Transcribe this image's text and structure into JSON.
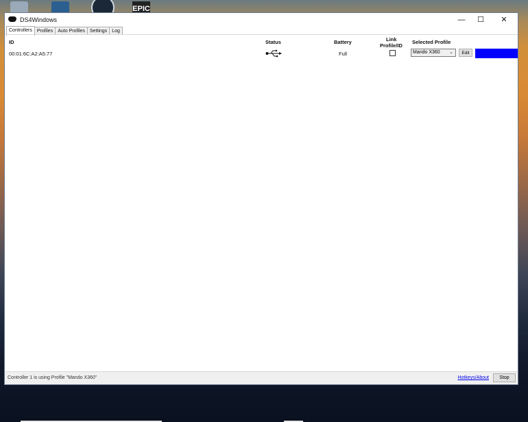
{
  "desktop": {
    "icons": [
      "recycle-bin-icon",
      "ds4windows-icon",
      "steam-icon",
      "epic-games-icon"
    ],
    "epic_label": "EPIC"
  },
  "window": {
    "title": "DS4Windows",
    "controls": {
      "minimize": "—",
      "maximize": "☐",
      "close": "✕"
    }
  },
  "tabs": [
    "Controllers",
    "Profiles",
    "Auto Profiles",
    "Settings",
    "Log"
  ],
  "table": {
    "headers": {
      "id": "ID",
      "status": "Status",
      "battery": "Battery",
      "link_line1": "Link",
      "link_line2": "Profile/ID",
      "selected_profile": "Selected Profile"
    },
    "rows": [
      {
        "id": "00:01:6C:A2:A5:77",
        "status_icon": "usb-icon",
        "battery": "Full",
        "link_checked": false,
        "profile": "Mando X360",
        "edit_label": "Edit",
        "lightbar_color": "#0000ff"
      }
    ]
  },
  "statusbar": {
    "message": "Controller 1 is using Profile \"Mando X360\"",
    "hotkeys_label": "Hotkeys/About",
    "stop_label": "Stop"
  }
}
